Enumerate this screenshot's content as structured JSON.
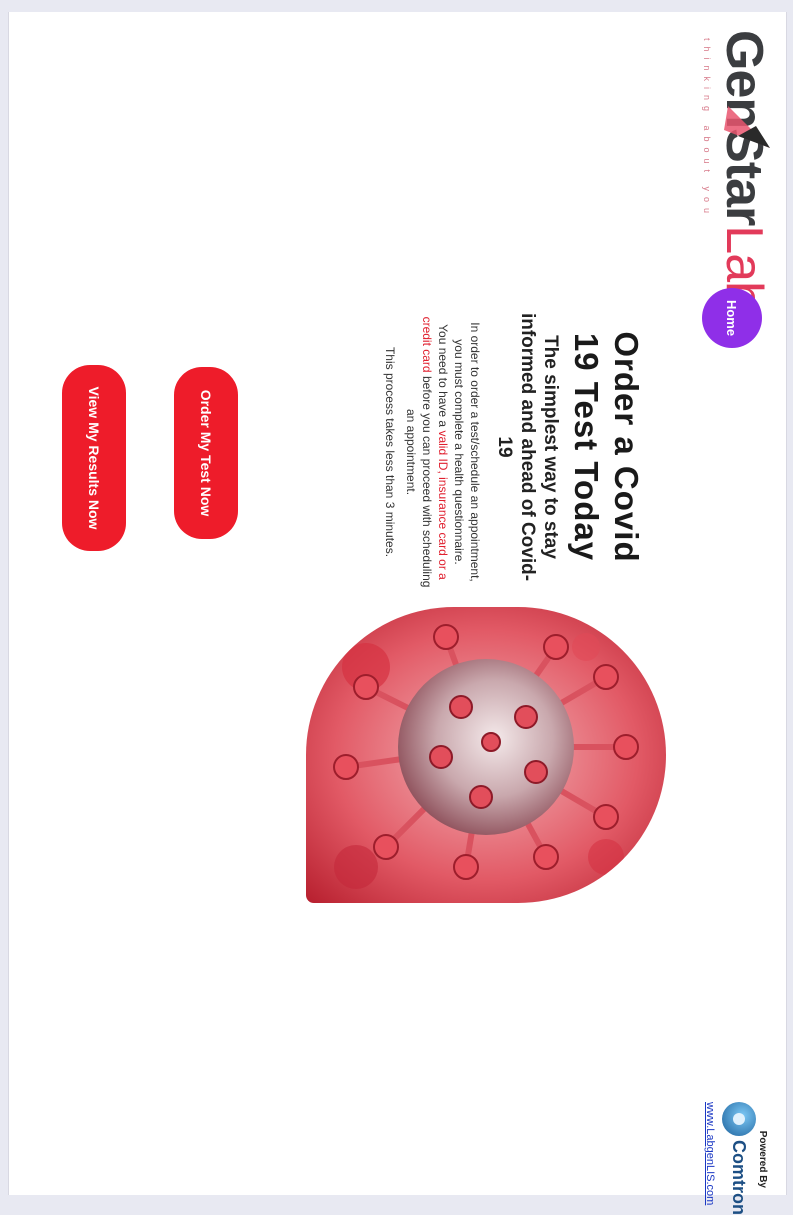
{
  "logo": {
    "brand_main": "GenStar",
    "brand_accent": "Labs",
    "tagline": "thinking about you"
  },
  "nav": {
    "home_label": "Home"
  },
  "hero": {
    "title": "Order a Covid 19 Test Today",
    "subtitle": "The simplest way to stay informed and ahead of Covid-19",
    "desc_1": "In order to order a test/schedule an appointment, you must complete a health questionnaire.",
    "desc_2_prefix": "You need to have a ",
    "desc_2_hl": "valid ID, insurance card or a credit card",
    "desc_2_suffix": " before you can proceed with scheduling an appointment.",
    "process_note": "This process takes less than 3 minutes."
  },
  "actions": {
    "order_label": "Order My Test Now",
    "results_label": "View My Results Now"
  },
  "footer": {
    "powered_by": "Powered By",
    "brand": "Comtron",
    "link_text": "www.LabgenLIS.com"
  },
  "colors": {
    "primary_red": "#ee1c2a",
    "home_purple": "#8f2fe8",
    "link_blue": "#1b38c4"
  }
}
